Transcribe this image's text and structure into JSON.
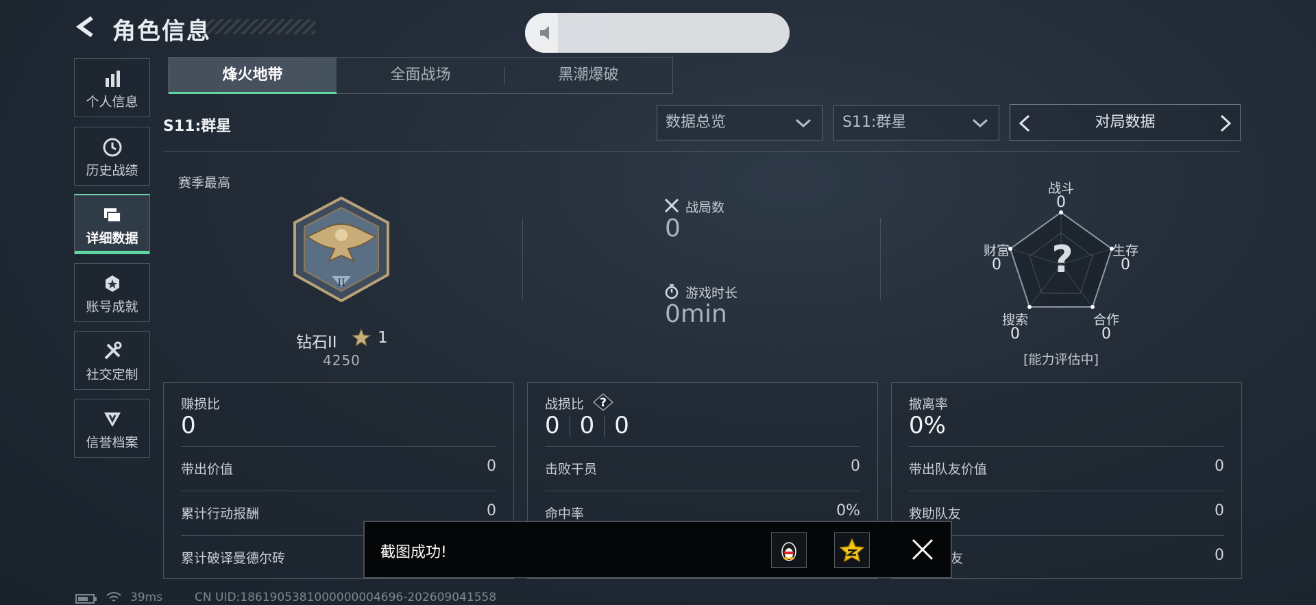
{
  "header": {
    "title": "角色信息"
  },
  "sidebar": {
    "items": [
      {
        "label": "个人信息",
        "icon": "bar-chart-icon"
      },
      {
        "label": "历史战绩",
        "icon": "clock-icon"
      },
      {
        "label": "详细数据",
        "icon": "folders-icon",
        "active": true
      },
      {
        "label": "账号成就",
        "icon": "medal-icon"
      },
      {
        "label": "社交定制",
        "icon": "tools-icon"
      },
      {
        "label": "信誉档案",
        "icon": "badge-icon"
      }
    ]
  },
  "tabs": [
    {
      "label": "烽火地带",
      "active": true
    },
    {
      "label": "全面战场"
    },
    {
      "label": "黑潮爆破"
    }
  ],
  "filters": {
    "season_label": "S11:群星",
    "view_select": "数据总览",
    "season_select": "S11:群星",
    "pager_label": "对局数据"
  },
  "overview": {
    "season_best_label": "赛季最高",
    "rank_name": "钻石II",
    "rank_stars": "1",
    "rank_score": "4250",
    "matches_label": "战局数",
    "matches_value": "0",
    "playtime_label": "游戏时长",
    "playtime_value": "0min"
  },
  "radar": {
    "center_mark": "?",
    "axes": [
      {
        "label": "战斗",
        "value": "0"
      },
      {
        "label": "生存",
        "value": "0"
      },
      {
        "label": "合作",
        "value": "0"
      },
      {
        "label": "搜索",
        "value": "0"
      },
      {
        "label": "财富",
        "value": "0"
      }
    ],
    "status": "[能力评估中]"
  },
  "boxes": [
    {
      "title": "赚损比",
      "main": "0",
      "rows": [
        {
          "label": "带出价值",
          "value": "0"
        },
        {
          "label": "累计行动报酬",
          "value": "0"
        },
        {
          "label": "累计破译曼德尔砖",
          "value": ""
        }
      ]
    },
    {
      "title": "战损比",
      "main_parts": [
        "0",
        "0",
        "0"
      ],
      "help": "?",
      "rows": [
        {
          "label": "击败干员",
          "value": "0"
        },
        {
          "label": "命中率",
          "value": "0%"
        },
        {
          "label": "",
          "value": ""
        }
      ]
    },
    {
      "title": "撤离率",
      "main": "0%",
      "rows": [
        {
          "label": "带出队友价值",
          "value": "0"
        },
        {
          "label": "救助队友",
          "value": "0"
        },
        {
          "label": "友",
          "value": "0"
        }
      ]
    }
  ],
  "toast": {
    "text": "截图成功!"
  },
  "footer": {
    "ping": "39ms",
    "uid": "CN UID:1861905381000000004696-202609041558"
  },
  "colors": {
    "accent": "#5fd7a0",
    "background": "#222b36",
    "toast_bg": "#050607"
  }
}
